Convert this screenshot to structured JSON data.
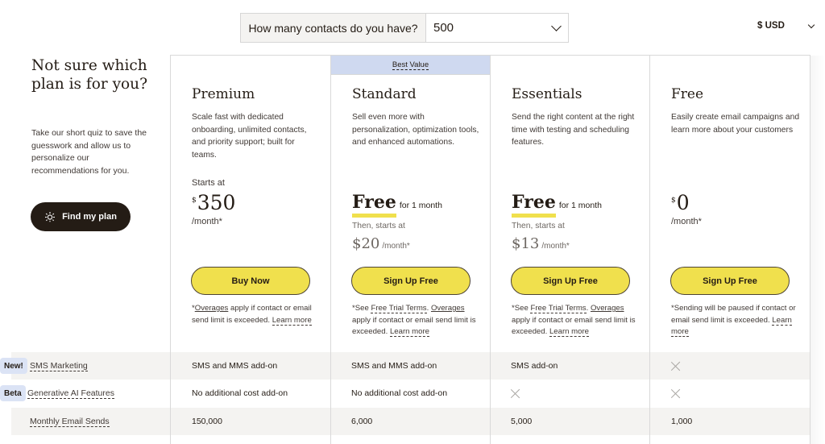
{
  "contacts": {
    "question": "How many contacts do you have?",
    "selected": "500"
  },
  "currency": {
    "label": "$ USD"
  },
  "sidebar": {
    "title": "Not sure which plan is for you?",
    "description": "Take our short quiz to save the guesswork and allow us to personalize our recommendations for you.",
    "button_label": "Find my plan",
    "button_icon": "sparkle-icon"
  },
  "best_value_label": "Best Value",
  "plans": [
    {
      "name": "Premium",
      "description": "Scale fast with dedicated onboarding, unlimited contacts, and priority support; built for teams.",
      "starts_at": "Starts at",
      "currency_symbol": "$",
      "price": "350",
      "per_month": "/month*",
      "cta": "Buy Now",
      "note_prefix": "*",
      "note_link1": "Overages",
      "note_text": " apply if contact or email send limit is exceeded. ",
      "note_learn": "Learn more"
    },
    {
      "name": "Standard",
      "description": "Sell even more with personalization, optimization tools, and enhanced automations.",
      "free_word": "Free",
      "free_suffix": "for 1 month",
      "then_text": "Then, starts at",
      "then_price": "$20",
      "then_per": "/month*",
      "cta": "Sign Up Free",
      "note_prefix": "*See ",
      "note_terms": "Free Trial Terms",
      "note_dot": ". ",
      "note_link1": "Overages",
      "note_text": " apply if contact or email send limit is exceeded. ",
      "note_learn": "Learn more"
    },
    {
      "name": "Essentials",
      "description": "Send the right content at the right time with testing and scheduling features.",
      "free_word": "Free",
      "free_suffix": "for 1 month",
      "then_text": "Then, starts at",
      "then_price": "$13",
      "then_per": "/month*",
      "cta": "Sign Up Free",
      "note_prefix": "*See ",
      "note_terms": "Free Trial Terms",
      "note_dot": ". ",
      "note_link1": "Overages",
      "note_text": " apply if contact or email send limit is exceeded. ",
      "note_learn": "Learn more"
    },
    {
      "name": "Free",
      "description": "Easily create email campaigns and learn more about your customers",
      "currency_symbol": "$",
      "price": "0",
      "per_month": "/month*",
      "cta": "Sign Up Free",
      "note_text": "*Sending will be paused if contact or email send limit is exceeded. ",
      "note_learn": "Learn more"
    }
  ],
  "features": [
    {
      "badge": "New!",
      "label": "SMS Marketing",
      "values": [
        "SMS and MMS add-on",
        "SMS and MMS add-on",
        "SMS add-on",
        null
      ],
      "shaded": true
    },
    {
      "badge": "Beta",
      "label": "Generative AI Features",
      "values": [
        "No additional cost add-on",
        "No additional cost add-on",
        null,
        null
      ],
      "shaded": false
    },
    {
      "badge": null,
      "label": "Monthly Email Sends",
      "values": [
        "150,000",
        "6,000",
        "5,000",
        "1,000"
      ],
      "shaded": true
    }
  ],
  "colors": {
    "accent_yellow": "#f0e04d",
    "dark": "#241c15",
    "best_value_bg": "#cfd9f0",
    "badge_bg": "#dbe3f5",
    "row_shade": "#f4f3f1"
  }
}
